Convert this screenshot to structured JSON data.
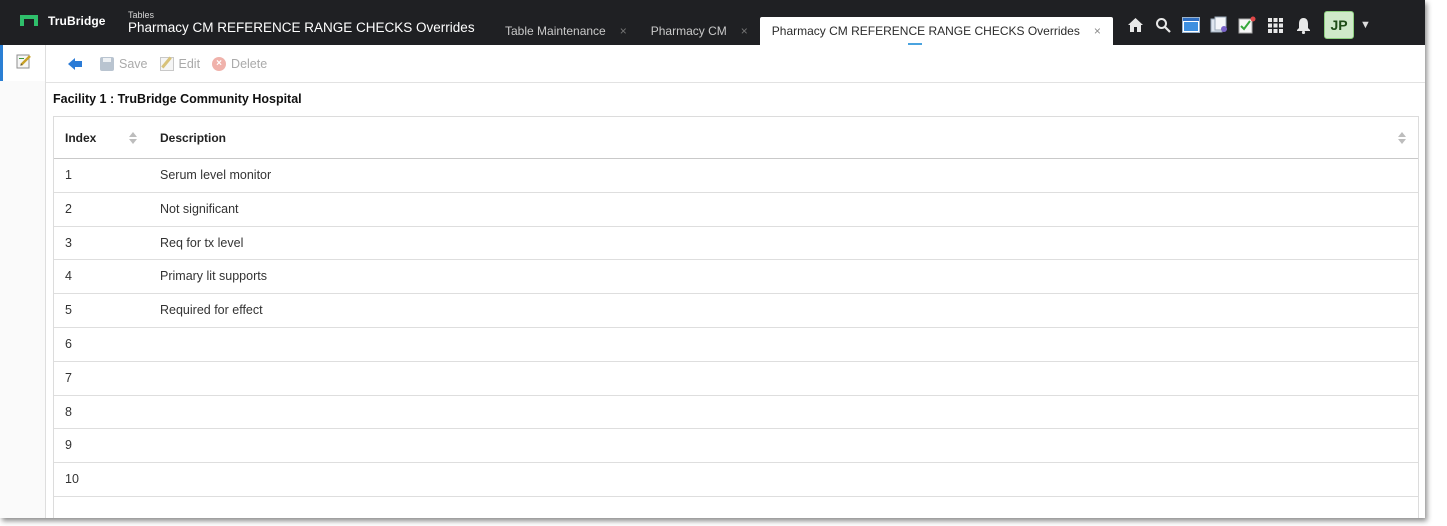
{
  "brand": {
    "name": "TruBridge"
  },
  "header": {
    "subtitle": "Tables",
    "title": "Pharmacy CM REFERENCE RANGE CHECKS Overrides"
  },
  "tabs": [
    {
      "label": "Table Maintenance",
      "close": "×"
    },
    {
      "label": "Pharmacy CM",
      "close": "×"
    },
    {
      "label": "Pharmacy CM REFERENCE RANGE CHECKS Overrides",
      "close": "×"
    }
  ],
  "top_icons": [
    "home-icon",
    "search-icon",
    "window-icon",
    "documents-icon",
    "tasks-icon",
    "apps-grid-icon",
    "bell-icon"
  ],
  "user": {
    "initials": "JP"
  },
  "toolbar": {
    "save_label": "Save",
    "edit_label": "Edit",
    "delete_label": "Delete"
  },
  "facility": "Facility 1 : TruBridge Community Hospital",
  "table": {
    "columns": [
      "Index",
      "Description"
    ],
    "rows": [
      {
        "index": "1",
        "description": "Serum level monitor"
      },
      {
        "index": "2",
        "description": "Not significant"
      },
      {
        "index": "3",
        "description": "Req for tx level"
      },
      {
        "index": "4",
        "description": "Primary lit supports"
      },
      {
        "index": "5",
        "description": "Required for effect"
      },
      {
        "index": "6",
        "description": ""
      },
      {
        "index": "7",
        "description": ""
      },
      {
        "index": "8",
        "description": ""
      },
      {
        "index": "9",
        "description": ""
      },
      {
        "index": "10",
        "description": ""
      }
    ]
  },
  "colors": {
    "topbar": "#1f2023",
    "accent": "#2a7fd4",
    "brand_green": "#2fbf6b"
  }
}
